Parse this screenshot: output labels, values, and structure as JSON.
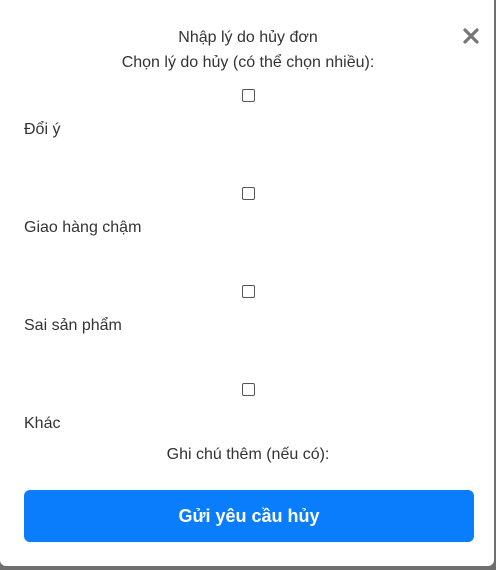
{
  "dialog": {
    "title": "Nhập lý do hủy đơn",
    "subtitle": "Chọn lý do hủy (có thể chọn nhiều):",
    "close_icon": "close-icon",
    "reasons": [
      {
        "label": "Đổi ý",
        "checked": false
      },
      {
        "label": "Giao hàng chậm",
        "checked": false
      },
      {
        "label": "Sai sản phẩm",
        "checked": false
      },
      {
        "label": "Khác",
        "checked": false
      }
    ],
    "note_label": "Ghi chú thêm (nếu có):",
    "submit_label": "Gửi yêu cầu hủy"
  },
  "colors": {
    "primary": "#0a7dfc",
    "text": "#333333",
    "backdrop": "#6f6f6f"
  }
}
